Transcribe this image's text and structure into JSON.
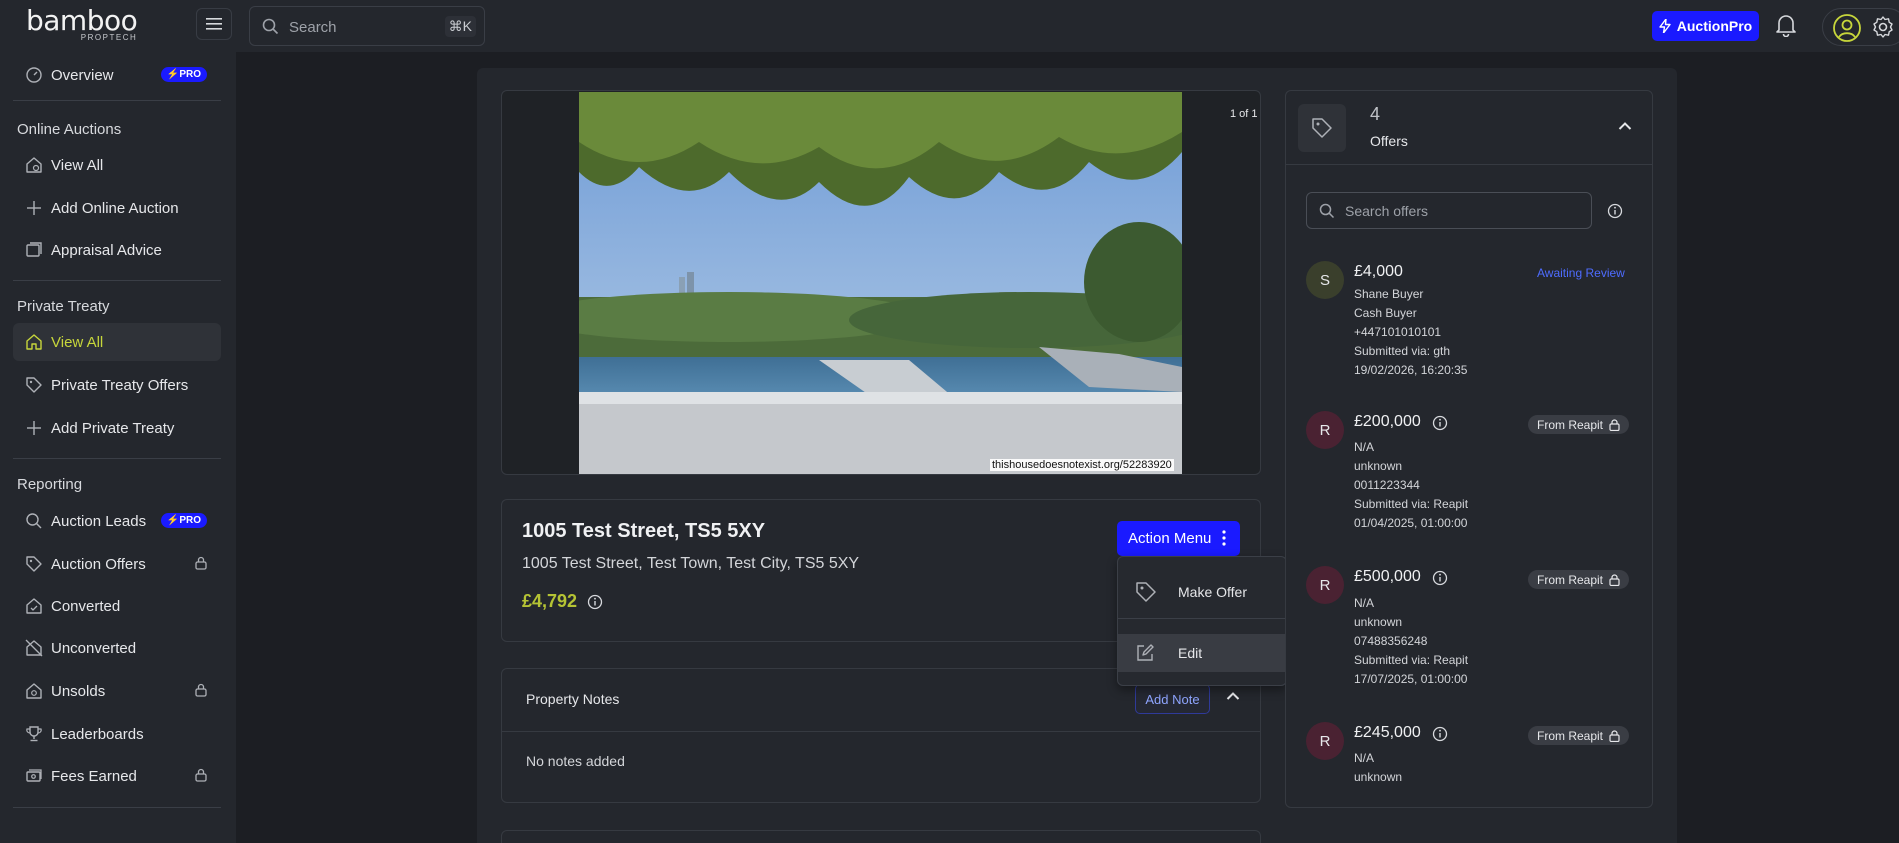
{
  "brand": {
    "name": "bamboo",
    "sub": "PROPTECH"
  },
  "header": {
    "search_placeholder": "Search",
    "search_shortcut": "⌘K",
    "auction_pro_label": "AuctionPro"
  },
  "sidebar": {
    "overview": {
      "label": "Overview",
      "badge": "PRO"
    },
    "sections": [
      {
        "title": "Online Auctions",
        "items": [
          {
            "label": "View All"
          },
          {
            "label": "Add Online Auction"
          },
          {
            "label": "Appraisal Advice"
          }
        ]
      },
      {
        "title": "Private Treaty",
        "items": [
          {
            "label": "View All"
          },
          {
            "label": "Private Treaty Offers"
          },
          {
            "label": "Add Private Treaty"
          }
        ]
      },
      {
        "title": "Reporting",
        "items": [
          {
            "label": "Auction Leads",
            "badge": "PRO"
          },
          {
            "label": "Auction Offers"
          },
          {
            "label": "Converted"
          },
          {
            "label": "Unconverted"
          },
          {
            "label": "Unsolds"
          },
          {
            "label": "Leaderboards"
          },
          {
            "label": "Fees Earned"
          }
        ]
      }
    ]
  },
  "property": {
    "image_counter": "1 of 1",
    "image_caption": "thishousedoesnotexist.org/52283920",
    "title": "1005 Test Street, TS5 5XY",
    "address": "1005 Test Street, Test Town, Test City, TS5 5XY",
    "price": "£4,792",
    "action_menu_label": "Action Menu",
    "action_menu_items": [
      {
        "label": "Make Offer"
      },
      {
        "label": "Edit"
      }
    ]
  },
  "notes": {
    "title": "Property Notes",
    "add_label": "Add Note",
    "empty_text": "No notes added"
  },
  "offers": {
    "count": "4",
    "label": "Offers",
    "search_placeholder": "Search offers",
    "items": [
      {
        "initial": "S",
        "amount": "£4,000",
        "status": "Awaiting Review",
        "name": "Shane Buyer",
        "buyer_type": "Cash Buyer",
        "phone": "+447101010101",
        "submitted_via": "Submitted via: gth",
        "date": "19/02/2026, 16:20:35"
      },
      {
        "initial": "R",
        "amount": "£200,000",
        "tag": "From Reapit",
        "name": "N/A",
        "buyer_type": "unknown",
        "phone": "0011223344",
        "submitted_via": "Submitted via: Reapit",
        "date": "01/04/2025, 01:00:00"
      },
      {
        "initial": "R",
        "amount": "£500,000",
        "tag": "From Reapit",
        "name": "N/A",
        "buyer_type": "unknown",
        "phone": "07488356248",
        "submitted_via": "Submitted via: Reapit",
        "date": "17/07/2025, 01:00:00"
      },
      {
        "initial": "R",
        "amount": "£245,000",
        "tag": "From Reapit",
        "name": "N/A",
        "buyer_type": "unknown"
      }
    ]
  },
  "colors": {
    "accent": "#1a1aff",
    "active_text": "#c7d63b",
    "price": "#b5c334",
    "awaiting": "#4e6cff"
  }
}
